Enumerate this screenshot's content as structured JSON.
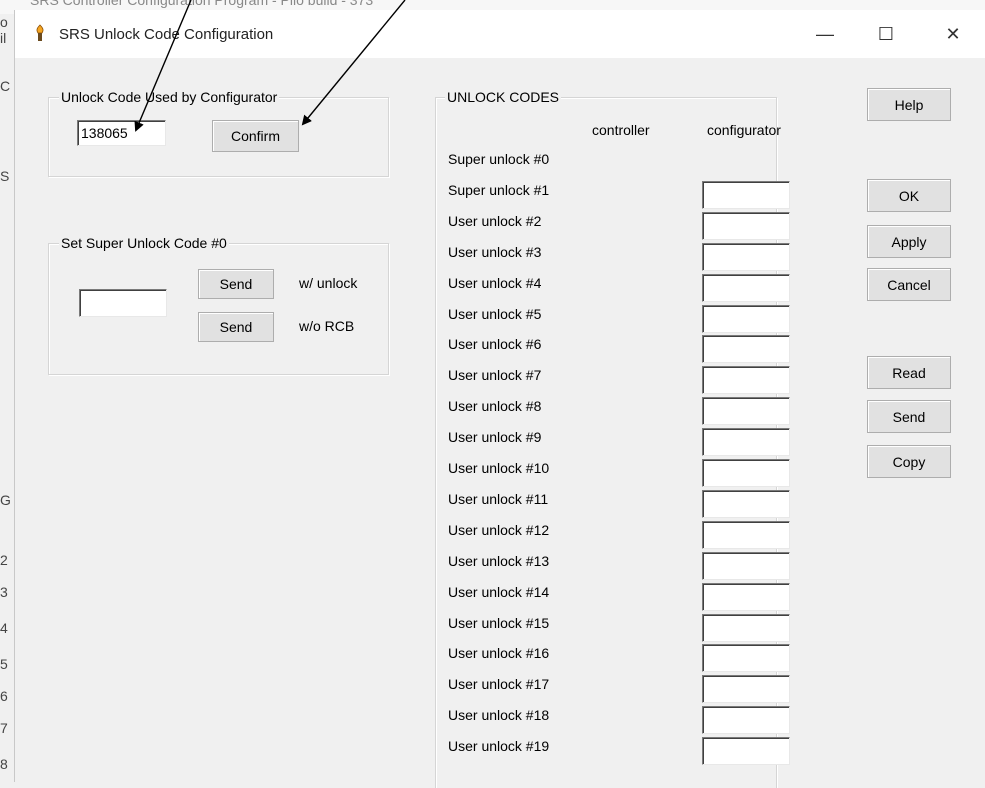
{
  "background_window": {
    "title": "SRS Controller Configuration Program - Pilo build - 373",
    "left_edge_letters": [
      "o",
      "il",
      "C",
      "S",
      "G",
      "2",
      "3",
      "4",
      "5",
      "6",
      "7",
      "8"
    ]
  },
  "dialog": {
    "title": "SRS Unlock Code Configuration",
    "icon": "torch-icon",
    "window_controls": {
      "minimize": "—",
      "maximize": "☐",
      "close": "✕"
    }
  },
  "unlock_used": {
    "legend": "Unlock Code Used by Configurator",
    "value": "138065",
    "confirm_label": "Confirm"
  },
  "super_unlock": {
    "legend": "Set Super Unlock Code #0",
    "value": "",
    "send_label_1": "Send",
    "send_suffix_1": "w/ unlock",
    "send_label_2": "Send",
    "send_suffix_2": "w/o RCB"
  },
  "codes": {
    "legend": "UNLOCK CODES",
    "col_controller": "controller",
    "col_configurator": "configurator",
    "rows": [
      {
        "label": "Super unlock #0",
        "value": "",
        "has_field": false
      },
      {
        "label": "Super unlock #1",
        "value": "",
        "has_field": true
      },
      {
        "label": "User unlock #2",
        "value": "",
        "has_field": true
      },
      {
        "label": "User unlock #3",
        "value": "",
        "has_field": true
      },
      {
        "label": "User unlock #4",
        "value": "",
        "has_field": true
      },
      {
        "label": "User unlock #5",
        "value": "",
        "has_field": true
      },
      {
        "label": "User unlock #6",
        "value": "",
        "has_field": true
      },
      {
        "label": "User unlock #7",
        "value": "",
        "has_field": true
      },
      {
        "label": "User unlock #8",
        "value": "",
        "has_field": true
      },
      {
        "label": "User unlock #9",
        "value": "",
        "has_field": true
      },
      {
        "label": "User unlock #10",
        "value": "",
        "has_field": true
      },
      {
        "label": "User unlock #11",
        "value": "",
        "has_field": true
      },
      {
        "label": "User unlock #12",
        "value": "",
        "has_field": true
      },
      {
        "label": "User unlock #13",
        "value": "",
        "has_field": true
      },
      {
        "label": "User unlock #14",
        "value": "",
        "has_field": true
      },
      {
        "label": "User unlock #15",
        "value": "",
        "has_field": true
      },
      {
        "label": "User unlock #16",
        "value": "",
        "has_field": true
      },
      {
        "label": "User unlock #17",
        "value": "",
        "has_field": true
      },
      {
        "label": "User unlock #18",
        "value": "",
        "has_field": true
      },
      {
        "label": "User unlock #19",
        "value": "",
        "has_field": true
      }
    ]
  },
  "side_buttons": {
    "help": "Help",
    "ok": "OK",
    "apply": "Apply",
    "cancel": "Cancel",
    "read": "Read",
    "send": "Send",
    "copy": "Copy"
  },
  "colors": {
    "dialog_bg": "#f0f0f0",
    "titlebar_bg": "#ffffff",
    "button_bg": "#e1e1e1",
    "annotation_arrow": "#000000"
  }
}
